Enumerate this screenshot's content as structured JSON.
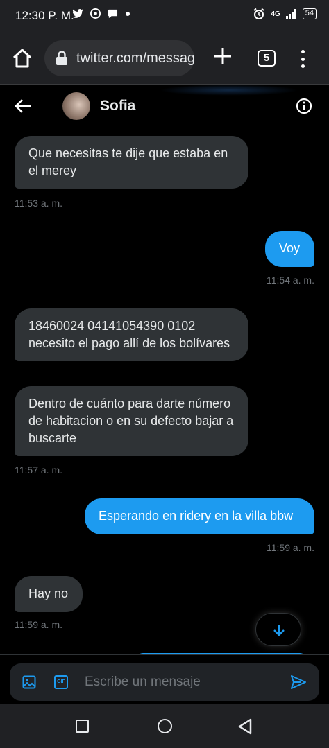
{
  "status_bar": {
    "time": "12:30 P. M.",
    "network": "4G",
    "battery": "54",
    "icons": [
      "twitter-icon",
      "chrome-icon",
      "chat-icon",
      "dot-icon",
      "alarm-icon",
      "signal-icon",
      "battery-icon"
    ]
  },
  "browser": {
    "url": "twitter.com/messag",
    "tab_count": "5"
  },
  "chat": {
    "contact_name": "Sofia",
    "messages": [
      {
        "direction": "in",
        "text": "Que necesitas te dije que estaba en el merey"
      },
      {
        "direction": "in_time",
        "text": "11:53 a. m."
      },
      {
        "direction": "out",
        "text": "Voy"
      },
      {
        "direction": "out_time",
        "text": "11:54 a. m."
      },
      {
        "direction": "in",
        "text": "18460024 04141054390 0102 necesito el pago allí de los bolívares"
      },
      {
        "direction": "in",
        "text": "Dentro de cuánto para darte número de habitacion o en su defecto bajar a buscarte"
      },
      {
        "direction": "in_time",
        "text": "11:57 a. m."
      },
      {
        "direction": "out",
        "text": "Esperando en ridery en la villa bbw"
      },
      {
        "direction": "out_time",
        "text": "11:59 a. m."
      },
      {
        "direction": "in",
        "text": "Hay no"
      },
      {
        "direction": "in_time",
        "text": "11:59 a. m."
      }
    ]
  },
  "composer": {
    "placeholder": "Escribe un mensaje"
  },
  "colors": {
    "accent": "#1d9bf0",
    "incoming_bubble": "#2f3336",
    "background": "#000000",
    "timestamp": "#71767b"
  }
}
